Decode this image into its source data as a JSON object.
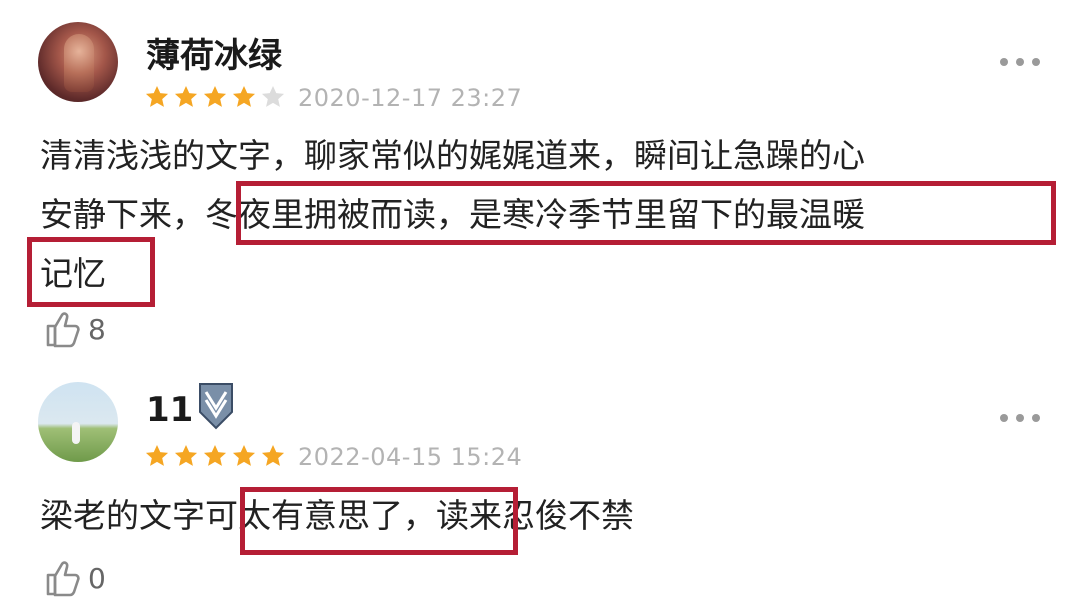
{
  "comments": [
    {
      "username": "薄荷冰绿",
      "rating": 4,
      "timestamp": "2020-12-17 23:27",
      "lines": [
        [
          "清清浅浅的文字，聊家常似的娓娓道来，瞬间让急躁的心"
        ],
        [
          "安静下来，",
          "冬夜里拥被而读，是寒冷季节里留下的最温暖"
        ],
        [
          "记忆"
        ]
      ],
      "likes": "8"
    },
    {
      "username": "11",
      "rating": 5,
      "timestamp": "2022-04-15 15:24",
      "lines": [
        [
          "梁老的文字",
          "可太有意思了，",
          "读来忍俊不禁"
        ]
      ],
      "likes": "0"
    }
  ],
  "colors": {
    "star_filled": "#f5a623",
    "star_empty": "#dcdcdc",
    "highlight_box": "#b51e35"
  },
  "icons": [
    "more-icon",
    "thumbs-up-icon",
    "badge-icon",
    "star-icon"
  ]
}
